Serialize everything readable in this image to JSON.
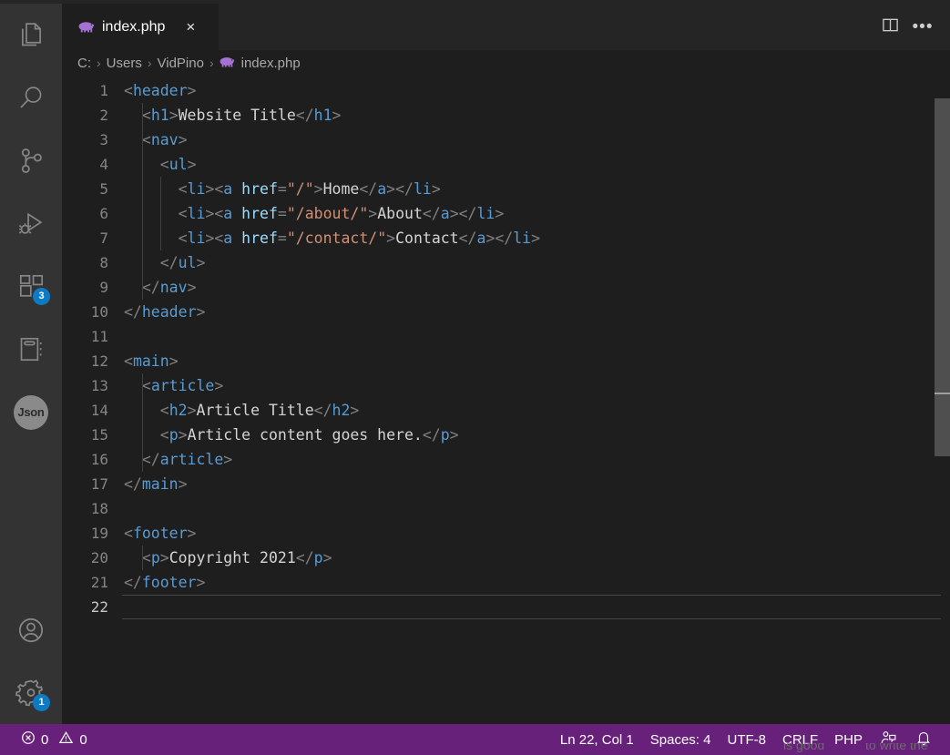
{
  "window": {
    "accent_color": "#68217a",
    "editor_bg": "#1e1e1e",
    "activitybar_bg": "#333333"
  },
  "activitybar": {
    "top_items": [
      {
        "name": "explorer",
        "icon": "files-icon",
        "label": "Explorer",
        "badge": ""
      },
      {
        "name": "search",
        "icon": "search-icon",
        "label": "Search",
        "badge": ""
      },
      {
        "name": "source-control",
        "icon": "source-control-icon",
        "label": "Source Control",
        "badge": ""
      },
      {
        "name": "run-debug",
        "icon": "run-debug-icon",
        "label": "Run and Debug",
        "badge": ""
      },
      {
        "name": "extensions",
        "icon": "extensions-icon",
        "label": "Extensions",
        "badge": "3"
      },
      {
        "name": "notebook",
        "icon": "notebook-icon",
        "label": "Notebook",
        "badge": ""
      },
      {
        "name": "json",
        "icon": "json-icon",
        "label": "Json",
        "badge": ""
      }
    ],
    "bottom_items": [
      {
        "name": "accounts",
        "icon": "account-icon",
        "label": "Accounts",
        "badge": ""
      },
      {
        "name": "settings",
        "icon": "gear-icon",
        "label": "Manage",
        "badge": "1"
      }
    ]
  },
  "tabs": [
    {
      "label": "index.php",
      "icon": "php-elephant-icon",
      "close": "×",
      "active": true
    }
  ],
  "tabbar_actions": {
    "split_editor": "split-editor-icon",
    "more_actions": "•••"
  },
  "breadcrumb": {
    "separator": "›",
    "items": [
      "C:",
      "Users",
      "VidPino"
    ],
    "file": "index.php",
    "file_icon": "php-elephant-icon"
  },
  "editor": {
    "language": "PHP",
    "active_line": 22,
    "lines": [
      {
        "n": 1,
        "indent": 0,
        "tokens": [
          [
            "punc",
            "<"
          ],
          [
            "tag",
            "header"
          ],
          [
            "punc",
            ">"
          ]
        ]
      },
      {
        "n": 2,
        "indent": 1,
        "tokens": [
          [
            "punc",
            "<"
          ],
          [
            "tag",
            "h1"
          ],
          [
            "punc",
            ">"
          ],
          [
            "text",
            "Website Title"
          ],
          [
            "punc",
            "</"
          ],
          [
            "tag",
            "h1"
          ],
          [
            "punc",
            ">"
          ]
        ]
      },
      {
        "n": 3,
        "indent": 1,
        "tokens": [
          [
            "punc",
            "<"
          ],
          [
            "tag",
            "nav"
          ],
          [
            "punc",
            ">"
          ]
        ]
      },
      {
        "n": 4,
        "indent": 2,
        "tokens": [
          [
            "punc",
            "<"
          ],
          [
            "tag",
            "ul"
          ],
          [
            "punc",
            ">"
          ]
        ]
      },
      {
        "n": 5,
        "indent": 3,
        "tokens": [
          [
            "punc",
            "<"
          ],
          [
            "tag",
            "li"
          ],
          [
            "punc",
            "><"
          ],
          [
            "tag",
            "a"
          ],
          [
            "text",
            " "
          ],
          [
            "attr",
            "href"
          ],
          [
            "punc",
            "="
          ],
          [
            "str",
            "\"/\""
          ],
          [
            "punc",
            ">"
          ],
          [
            "text",
            "Home"
          ],
          [
            "punc",
            "</"
          ],
          [
            "tag",
            "a"
          ],
          [
            "punc",
            "></"
          ],
          [
            "tag",
            "li"
          ],
          [
            "punc",
            ">"
          ]
        ]
      },
      {
        "n": 6,
        "indent": 3,
        "tokens": [
          [
            "punc",
            "<"
          ],
          [
            "tag",
            "li"
          ],
          [
            "punc",
            "><"
          ],
          [
            "tag",
            "a"
          ],
          [
            "text",
            " "
          ],
          [
            "attr",
            "href"
          ],
          [
            "punc",
            "="
          ],
          [
            "str",
            "\"/about/\""
          ],
          [
            "punc",
            ">"
          ],
          [
            "text",
            "About"
          ],
          [
            "punc",
            "</"
          ],
          [
            "tag",
            "a"
          ],
          [
            "punc",
            "></"
          ],
          [
            "tag",
            "li"
          ],
          [
            "punc",
            ">"
          ]
        ]
      },
      {
        "n": 7,
        "indent": 3,
        "tokens": [
          [
            "punc",
            "<"
          ],
          [
            "tag",
            "li"
          ],
          [
            "punc",
            "><"
          ],
          [
            "tag",
            "a"
          ],
          [
            "text",
            " "
          ],
          [
            "attr",
            "href"
          ],
          [
            "punc",
            "="
          ],
          [
            "str",
            "\"/contact/\""
          ],
          [
            "punc",
            ">"
          ],
          [
            "text",
            "Contact"
          ],
          [
            "punc",
            "</"
          ],
          [
            "tag",
            "a"
          ],
          [
            "punc",
            "></"
          ],
          [
            "tag",
            "li"
          ],
          [
            "punc",
            ">"
          ]
        ]
      },
      {
        "n": 8,
        "indent": 2,
        "tokens": [
          [
            "punc",
            "</"
          ],
          [
            "tag",
            "ul"
          ],
          [
            "punc",
            ">"
          ]
        ]
      },
      {
        "n": 9,
        "indent": 1,
        "tokens": [
          [
            "punc",
            "</"
          ],
          [
            "tag",
            "nav"
          ],
          [
            "punc",
            ">"
          ]
        ]
      },
      {
        "n": 10,
        "indent": 0,
        "tokens": [
          [
            "punc",
            "</"
          ],
          [
            "tag",
            "header"
          ],
          [
            "punc",
            ">"
          ]
        ]
      },
      {
        "n": 11,
        "indent": 0,
        "tokens": []
      },
      {
        "n": 12,
        "indent": 0,
        "tokens": [
          [
            "punc",
            "<"
          ],
          [
            "tag",
            "main"
          ],
          [
            "punc",
            ">"
          ]
        ]
      },
      {
        "n": 13,
        "indent": 1,
        "tokens": [
          [
            "punc",
            "<"
          ],
          [
            "tag",
            "article"
          ],
          [
            "punc",
            ">"
          ]
        ]
      },
      {
        "n": 14,
        "indent": 2,
        "tokens": [
          [
            "punc",
            "<"
          ],
          [
            "tag",
            "h2"
          ],
          [
            "punc",
            ">"
          ],
          [
            "text",
            "Article Title"
          ],
          [
            "punc",
            "</"
          ],
          [
            "tag",
            "h2"
          ],
          [
            "punc",
            ">"
          ]
        ]
      },
      {
        "n": 15,
        "indent": 2,
        "tokens": [
          [
            "punc",
            "<"
          ],
          [
            "tag",
            "p"
          ],
          [
            "punc",
            ">"
          ],
          [
            "text",
            "Article content goes here."
          ],
          [
            "punc",
            "</"
          ],
          [
            "tag",
            "p"
          ],
          [
            "punc",
            ">"
          ]
        ]
      },
      {
        "n": 16,
        "indent": 1,
        "tokens": [
          [
            "punc",
            "</"
          ],
          [
            "tag",
            "article"
          ],
          [
            "punc",
            ">"
          ]
        ]
      },
      {
        "n": 17,
        "indent": 0,
        "tokens": [
          [
            "punc",
            "</"
          ],
          [
            "tag",
            "main"
          ],
          [
            "punc",
            ">"
          ]
        ]
      },
      {
        "n": 18,
        "indent": 0,
        "tokens": []
      },
      {
        "n": 19,
        "indent": 0,
        "tokens": [
          [
            "punc",
            "<"
          ],
          [
            "tag",
            "footer"
          ],
          [
            "punc",
            ">"
          ]
        ]
      },
      {
        "n": 20,
        "indent": 1,
        "tokens": [
          [
            "punc",
            "<"
          ],
          [
            "tag",
            "p"
          ],
          [
            "punc",
            ">"
          ],
          [
            "text",
            "Copyright 2021"
          ],
          [
            "punc",
            "</"
          ],
          [
            "tag",
            "p"
          ],
          [
            "punc",
            ">"
          ]
        ]
      },
      {
        "n": 21,
        "indent": 0,
        "tokens": [
          [
            "punc",
            "</"
          ],
          [
            "tag",
            "footer"
          ],
          [
            "punc",
            ">"
          ]
        ]
      },
      {
        "n": 22,
        "indent": 0,
        "tokens": []
      }
    ],
    "indent_guides": [
      {
        "x": 1,
        "from": 2,
        "to": 9
      },
      {
        "x": 2,
        "from": 5,
        "to": 7
      },
      {
        "x": 1,
        "from": 13,
        "to": 16
      },
      {
        "x": 1,
        "from": 20,
        "to": 20
      }
    ]
  },
  "statusbar": {
    "errors_icon": "error-circle-icon",
    "errors": "0",
    "warnings_icon": "warning-triangle-icon",
    "warnings": "0",
    "position": "Ln 22, Col 1",
    "indentation": "Spaces: 4",
    "encoding": "UTF-8",
    "eol": "CRLF",
    "language": "PHP",
    "feedback_icon": "feedback-person-icon",
    "bell_icon": "bell-icon",
    "ghost_left": "is good",
    "ghost_right": "to write the"
  }
}
